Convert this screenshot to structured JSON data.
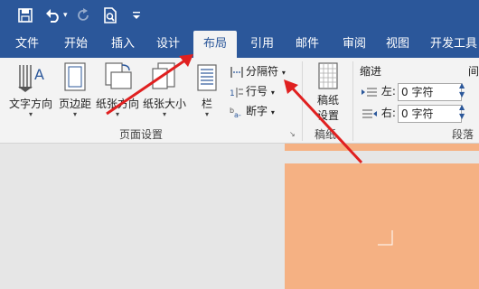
{
  "qat": {
    "save_icon": "save-icon",
    "undo_icon": "undo-icon",
    "redo_icon": "redo-icon",
    "preview_icon": "print-preview-icon",
    "customize_icon": "customize-qat-icon"
  },
  "tabs": [
    "文件",
    "开始",
    "插入",
    "设计",
    "布局",
    "引用",
    "邮件",
    "审阅",
    "视图",
    "开发工具"
  ],
  "active_tab": "布局",
  "page_setup": {
    "text_direction": "文字方向",
    "margins": "页边距",
    "orientation": "纸张方向",
    "size": "纸张大小",
    "columns": "栏",
    "breaks": "分隔符",
    "line_numbers": "行号",
    "hyphenation": "断字",
    "group_label": "页面设置"
  },
  "manuscript": {
    "settings_line1": "稿纸",
    "settings_line2": "设置",
    "group_label": "稿纸"
  },
  "paragraph": {
    "indent_label": "缩进",
    "spacing_label": "间",
    "left_label": "左:",
    "left_value": "0 字符",
    "right_label": "右:",
    "right_value": "0 字符",
    "group_label": "段落"
  },
  "colors": {
    "ribbon_blue": "#2b579a",
    "page_color": "#f5b183",
    "arrow_red": "#e02020"
  }
}
